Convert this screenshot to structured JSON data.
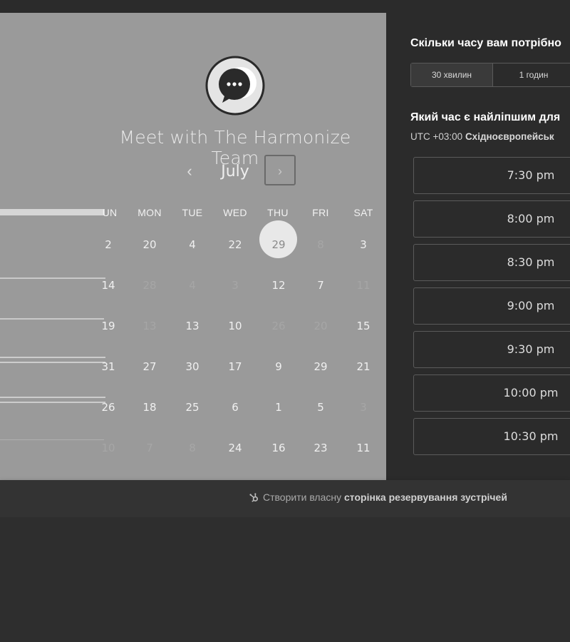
{
  "meeting": {
    "title": "Meet with The Harmonize Team"
  },
  "calendar": {
    "month": "July",
    "prev_icon": "‹",
    "next_icon": "›",
    "weekdays": [
      "UN",
      "MON",
      "TUE",
      "WED",
      "THU",
      "FRI",
      "SAT"
    ],
    "rows": [
      [
        "2",
        "20",
        "4",
        "22",
        "29",
        "8",
        "3"
      ],
      [
        "14",
        "28",
        "4",
        "3",
        "12",
        "7",
        "11"
      ],
      [
        "19",
        "13",
        "13",
        "10",
        "26",
        "20",
        "15"
      ],
      [
        "31",
        "27",
        "30",
        "17",
        "9",
        "29",
        "21"
      ],
      [
        "26",
        "18",
        "25",
        "6",
        "1",
        "5",
        "3"
      ],
      [
        "10",
        "7",
        "8",
        "24",
        "16",
        "23",
        "11"
      ]
    ],
    "selected": "29"
  },
  "duration": {
    "question": "Скільки часу вам потрібно",
    "options": [
      "30 хвилин",
      "1 годин"
    ],
    "selected": "30 хвилин"
  },
  "time": {
    "question": "Який час є найліпшим для",
    "timezone_offset": "UTC +03:00",
    "timezone_name": "Східноєвропейськ",
    "slots": [
      "7:30 pm",
      "8:00 pm",
      "8:30 pm",
      "9:00 pm",
      "9:30 pm",
      "10:00 pm",
      "10:30 pm"
    ]
  },
  "footer": {
    "prefix": "Створити власну",
    "link": "сторінка резервування зустрічей"
  },
  "colors": {
    "left_panel": "#9a9a9a",
    "right_panel": "#2b2b2b",
    "selected_day": "#e8e8e8"
  }
}
